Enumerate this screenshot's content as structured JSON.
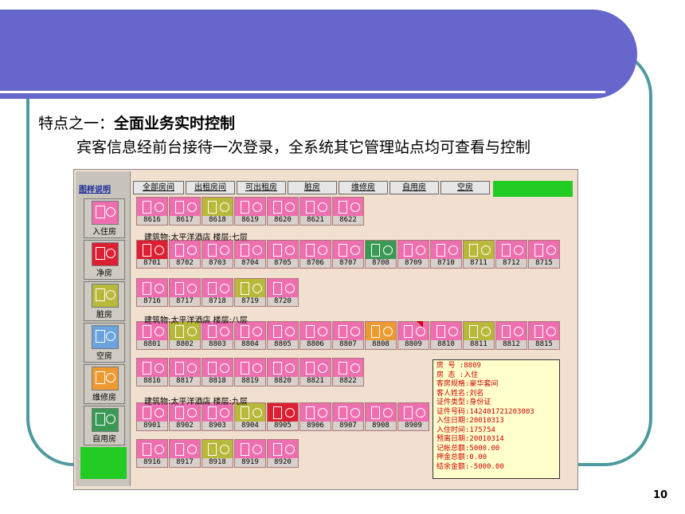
{
  "slide": {
    "heading_prefix": "特点之一：",
    "heading_bold": "全面业务实时控制",
    "subheading": "宾客信息经前台接待一次登录，全系统其它管理站点均可查看与控制",
    "page_number": "10",
    "colors": {
      "banner": "#6666cc",
      "frame": "#4f9aa0"
    }
  },
  "app": {
    "legend": {
      "title": "图样说明",
      "items": [
        {
          "label": "入住房",
          "color": "#ee6fb0"
        },
        {
          "label": "净房",
          "color": "#dd1f33"
        },
        {
          "label": "脏房",
          "color": "#b8b83a"
        },
        {
          "label": "空房",
          "color": "#6aa3dd"
        },
        {
          "label": "维修房",
          "color": "#ee9a33"
        },
        {
          "label": "自用房",
          "color": "#3a9a55"
        }
      ]
    },
    "tabs": [
      "全部房间",
      "出租房间",
      "可出租房",
      "脏房",
      "维修房",
      "自用房",
      "空房"
    ],
    "floors": [
      "建筑物:太平洋酒店   楼层:七层",
      "建筑物:太平洋酒店   楼层:八层",
      "建筑物:太平洋酒店   楼层:九层"
    ],
    "rooms": [
      {
        "num": "8616",
        "status": "occupied"
      },
      {
        "num": "8617",
        "status": "occupied"
      },
      {
        "num": "8618",
        "status": "dirty"
      },
      {
        "num": "8619",
        "status": "occupied"
      },
      {
        "num": "8620",
        "status": "occupied"
      },
      {
        "num": "8621",
        "status": "occupied"
      },
      {
        "num": "8622",
        "status": "occupied"
      },
      {
        "num": "8701",
        "status": "clean"
      },
      {
        "num": "8702",
        "status": "occupied"
      },
      {
        "num": "8703",
        "status": "occupied"
      },
      {
        "num": "8704",
        "status": "occupied"
      },
      {
        "num": "8705",
        "status": "occupied"
      },
      {
        "num": "8706",
        "status": "occupied"
      },
      {
        "num": "8707",
        "status": "occupied"
      },
      {
        "num": "8708",
        "status": "self"
      },
      {
        "num": "8709",
        "status": "occupied"
      },
      {
        "num": "8710",
        "status": "occupied"
      },
      {
        "num": "8711",
        "status": "dirty"
      },
      {
        "num": "8712",
        "status": "occupied"
      },
      {
        "num": "8715",
        "status": "occupied"
      },
      {
        "num": "8716",
        "status": "occupied"
      },
      {
        "num": "8717",
        "status": "occupied"
      },
      {
        "num": "8718",
        "status": "occupied"
      },
      {
        "num": "8719",
        "status": "dirty"
      },
      {
        "num": "8720",
        "status": "occupied"
      },
      {
        "num": "8801",
        "status": "occupied"
      },
      {
        "num": "8802",
        "status": "dirty"
      },
      {
        "num": "8803",
        "status": "occupied"
      },
      {
        "num": "8804",
        "status": "occupied"
      },
      {
        "num": "8805",
        "status": "occupied"
      },
      {
        "num": "8806",
        "status": "occupied"
      },
      {
        "num": "8807",
        "status": "occupied"
      },
      {
        "num": "8808",
        "status": "repair"
      },
      {
        "num": "8809",
        "status": "occupied"
      },
      {
        "num": "8810",
        "status": "occupied"
      },
      {
        "num": "8811",
        "status": "dirty"
      },
      {
        "num": "8812",
        "status": "occupied"
      },
      {
        "num": "8815",
        "status": "occupied"
      },
      {
        "num": "8816",
        "status": "occupied"
      },
      {
        "num": "8817",
        "status": "occupied"
      },
      {
        "num": "8818",
        "status": "occupied"
      },
      {
        "num": "8819",
        "status": "occupied"
      },
      {
        "num": "8820",
        "status": "occupied"
      },
      {
        "num": "8821",
        "status": "occupied"
      },
      {
        "num": "8822",
        "status": "occupied"
      },
      {
        "num": "8901",
        "status": "occupied"
      },
      {
        "num": "8902",
        "status": "occupied"
      },
      {
        "num": "8903",
        "status": "occupied"
      },
      {
        "num": "8904",
        "status": "dirty"
      },
      {
        "num": "8905",
        "status": "clean"
      },
      {
        "num": "8906",
        "status": "occupied"
      },
      {
        "num": "8907",
        "status": "occupied"
      },
      {
        "num": "8908",
        "status": "occupied"
      },
      {
        "num": "8909",
        "status": "occupied"
      },
      {
        "num": "8916",
        "status": "occupied"
      },
      {
        "num": "8917",
        "status": "occupied"
      },
      {
        "num": "8918",
        "status": "dirty"
      },
      {
        "num": "8919",
        "status": "occupied"
      },
      {
        "num": "8920",
        "status": "occupied"
      }
    ],
    "tooltip": [
      "房  号  :8809",
      "房  态  :入住",
      "客房规格:豪华套间",
      "客人姓名:刘名",
      "证件类型:身份证",
      "证件号码:142401721203003",
      "入住日期:20010313",
      "入住时间:175754",
      "预离日期:20010314",
      "记帐总额:5000.00",
      "押金总额:0.00",
      "结余金额:-5000.00"
    ]
  }
}
